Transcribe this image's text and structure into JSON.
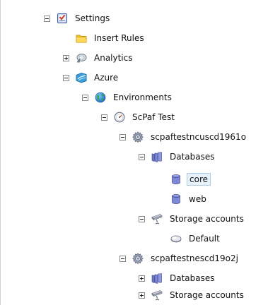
{
  "tree": {
    "settings": "Settings",
    "insert_rules": "Insert Rules",
    "analytics": "Analytics",
    "azure": "Azure",
    "environments": "Environments",
    "scpaf_test": "ScPaf Test",
    "service1": "scpaftestncuscd1961o",
    "service1_databases": "Databases",
    "db_core": "core",
    "db_web": "web",
    "service1_storage": "Storage accounts",
    "storage_default": "Default",
    "service2": "scpaftestnescd19o2j",
    "service2_databases": "Databases",
    "service2_storage": "Storage accounts"
  }
}
